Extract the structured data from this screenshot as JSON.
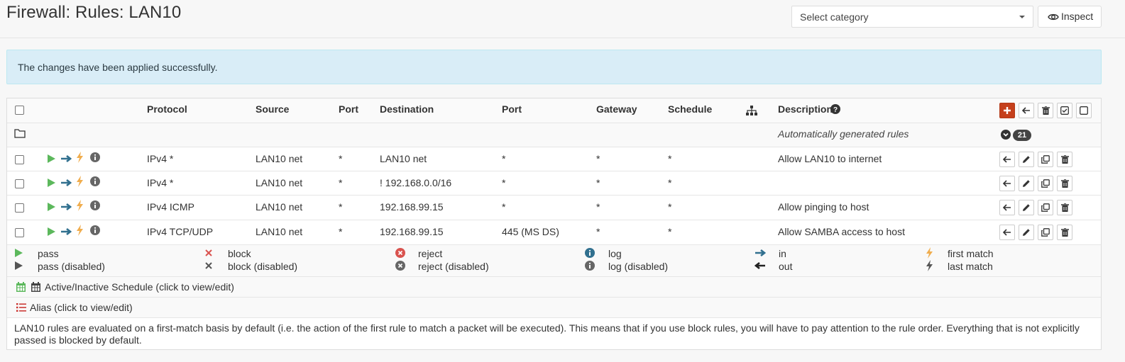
{
  "page": {
    "title": "Firewall: Rules: LAN10",
    "category_select": "Select category",
    "inspect_label": "Inspect"
  },
  "alert": {
    "message": "The changes have been applied successfully."
  },
  "table": {
    "headers": {
      "protocol": "Protocol",
      "source": "Source",
      "port": "Port",
      "destination": "Destination",
      "dest_port": "Port",
      "gateway": "Gateway",
      "schedule": "Schedule",
      "description": "Description"
    },
    "group_row": {
      "description": "Automatically generated rules",
      "count": "21"
    },
    "rules": [
      {
        "protocol": "IPv4 *",
        "source": "LAN10 net",
        "port": "*",
        "destination": "LAN10 net",
        "dest_port": "*",
        "gateway": "*",
        "schedule": "*",
        "description": "Allow LAN10 to internet"
      },
      {
        "protocol": "IPv4 *",
        "source": "LAN10 net",
        "port": "*",
        "destination": "! 192.168.0.0/16",
        "dest_port": "*",
        "gateway": "*",
        "schedule": "*",
        "description": ""
      },
      {
        "protocol": "IPv4 ICMP",
        "source": "LAN10 net",
        "port": "*",
        "destination": "192.168.99.15",
        "dest_port": "*",
        "gateway": "*",
        "schedule": "*",
        "description": "Allow pinging to host"
      },
      {
        "protocol": "IPv4 TCP/UDP",
        "source": "LAN10 net",
        "port": "*",
        "destination": "192.168.99.15",
        "dest_port": "445 (MS DS)",
        "gateway": "*",
        "schedule": "*",
        "description": "Allow SAMBA access to host"
      }
    ]
  },
  "legend": {
    "pass": "pass",
    "pass_disabled": "pass (disabled)",
    "block": "block",
    "block_disabled": "block (disabled)",
    "reject": "reject",
    "reject_disabled": "reject (disabled)",
    "log": "log",
    "log_disabled": "log (disabled)",
    "in": "in",
    "out": "out",
    "first_match": "first match",
    "last_match": "last match",
    "schedule_text": "Active/Inactive Schedule (click to view/edit)",
    "alias_text": "Alias (click to view/edit)",
    "note": "LAN10 rules are evaluated on a first-match basis by default (i.e. the action of the first rule to match a packet will be executed). This means that if you use block rules, you will have to pay attention to the rule order. Everything that is not explicitly passed is blocked by default."
  },
  "colors": {
    "pass": "#5cb85c",
    "block": "#d9534f",
    "direction": "#31708f",
    "match": "#f0ad4e",
    "add_button": "#c5401c",
    "alert_bg": "#d9edf7"
  },
  "icons": {
    "pass": "play-icon",
    "direction_in": "arrow-right-icon",
    "first_match": "bolt-icon",
    "log": "info-circle-icon",
    "move": "arrow-left-icon",
    "edit": "pencil-icon",
    "clone": "clone-icon",
    "delete": "trash-icon",
    "folder": "folder-icon",
    "expand": "chevron-down-circle-icon",
    "gateway": "sitemap-icon",
    "help": "question-circle-icon",
    "calendar": "calendar-icon",
    "list": "list-icon"
  }
}
